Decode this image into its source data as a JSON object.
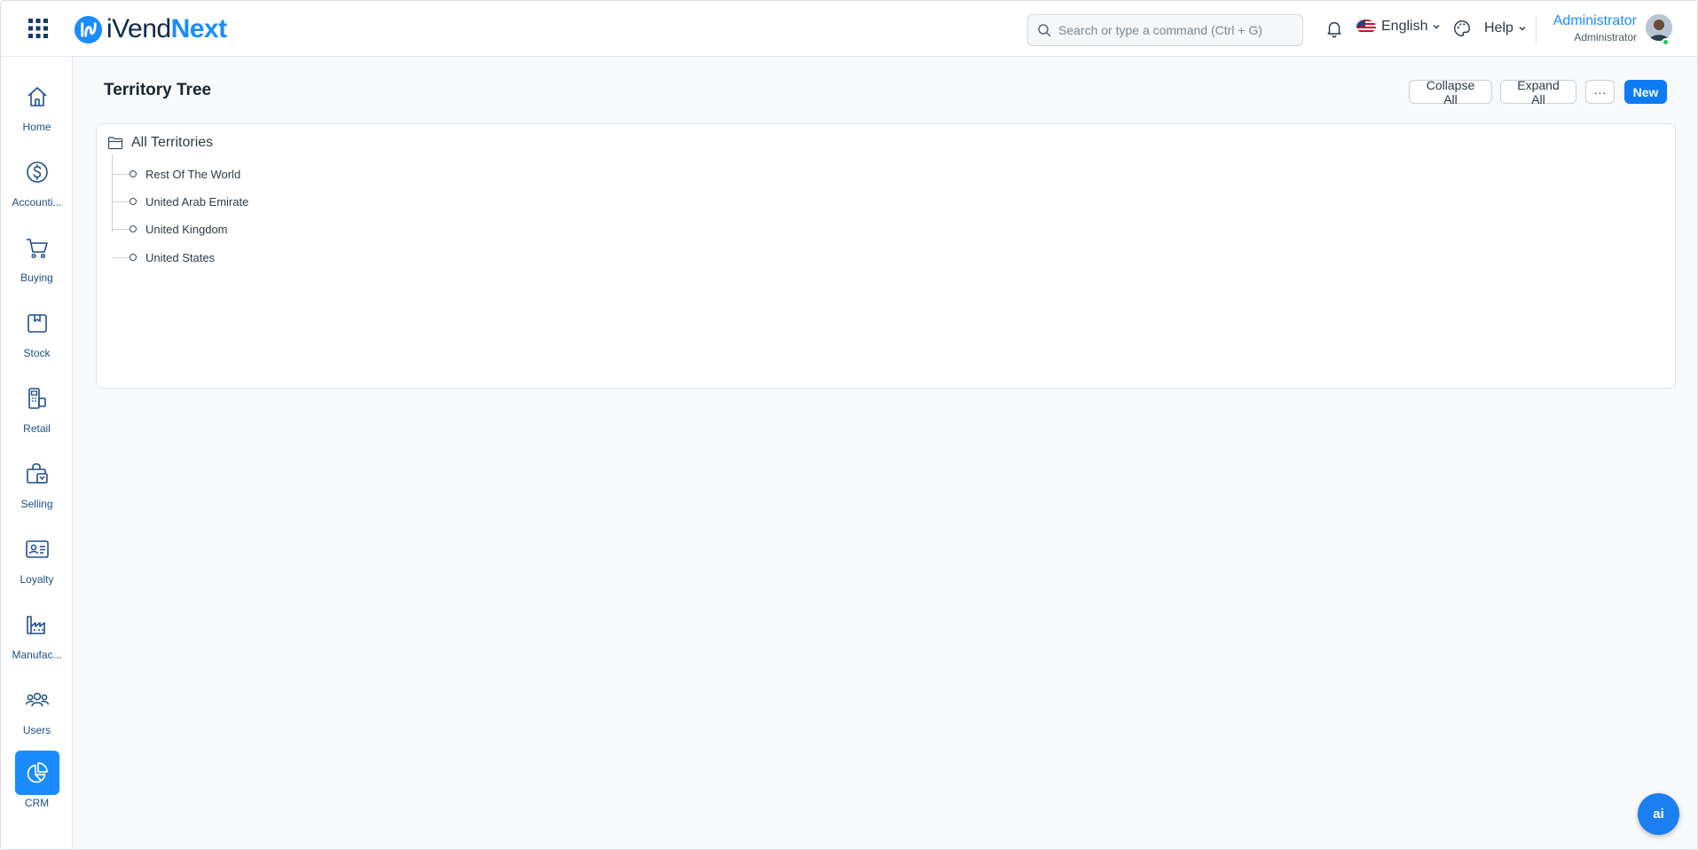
{
  "header": {
    "logo_part1": "iVend",
    "logo_part2": "Next",
    "search_placeholder": "Search or type a command (Ctrl + G)",
    "language": "English",
    "help": "Help",
    "user_name": "Administrator",
    "user_role": "Administrator"
  },
  "sidebar": {
    "items": [
      {
        "label": "Home",
        "icon": "home-icon"
      },
      {
        "label": "Accounti...",
        "icon": "dollar-icon"
      },
      {
        "label": "Buying",
        "icon": "cart-icon"
      },
      {
        "label": "Stock",
        "icon": "box-icon"
      },
      {
        "label": "Retail",
        "icon": "pos-icon"
      },
      {
        "label": "Selling",
        "icon": "bag-icon"
      },
      {
        "label": "Loyalty",
        "icon": "id-card-icon"
      },
      {
        "label": "Manufac...",
        "icon": "factory-icon"
      },
      {
        "label": "Users",
        "icon": "users-icon"
      },
      {
        "label": "CRM",
        "icon": "pie-chart-icon"
      }
    ],
    "active": "CRM"
  },
  "page": {
    "title": "Territory Tree",
    "collapse_all": "Collapse All",
    "expand_all": "Expand All",
    "more": "···",
    "new": "New"
  },
  "tree": {
    "root": "All Territories",
    "children": [
      "Rest Of The World",
      "United Arab Emirate",
      "United Kingdom",
      "United States"
    ]
  },
  "ai_button": "ai",
  "colors": {
    "accent": "#1a8cff",
    "primary_button": "#0d7cf2",
    "nav_text": "#1d4f8a"
  }
}
